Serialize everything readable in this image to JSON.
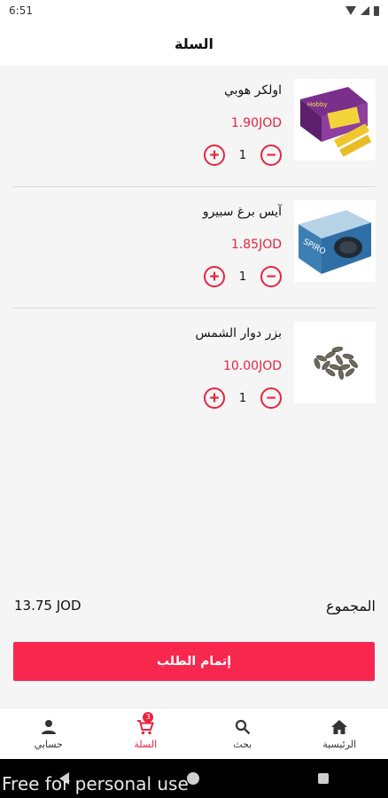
{
  "status_bar": {
    "time": "6:51"
  },
  "header": {
    "title": "السلة"
  },
  "cart": {
    "items": [
      {
        "name": "اولكر هوبي",
        "price": "1.90JOD",
        "quantity": "1",
        "image_icon": "wafer-box-image"
      },
      {
        "name": "آيس برغ سبيرو",
        "price": "1.85JOD",
        "quantity": "1",
        "image_icon": "biscuit-box-image"
      },
      {
        "name": "بزر دوار الشمس",
        "price": "10.00JOD",
        "quantity": "1",
        "image_icon": "sunflower-seeds-image"
      }
    ],
    "increment_symbol": "+",
    "decrement_symbol": "−"
  },
  "total": {
    "label": "المجموع",
    "value": "13.75 JOD"
  },
  "checkout": {
    "label": "إتمام الطلب"
  },
  "bottom_nav": {
    "items": [
      {
        "label": "الرئيسية",
        "icon": "home-icon"
      },
      {
        "label": "بحث",
        "icon": "search-icon"
      },
      {
        "label": "السلة",
        "icon": "cart-icon",
        "badge": "3",
        "active": true
      },
      {
        "label": "حسابي",
        "icon": "account-icon"
      }
    ]
  },
  "watermark": "Free for personal use",
  "colors": {
    "accent": "#e8233f",
    "button": "#f8274d"
  }
}
